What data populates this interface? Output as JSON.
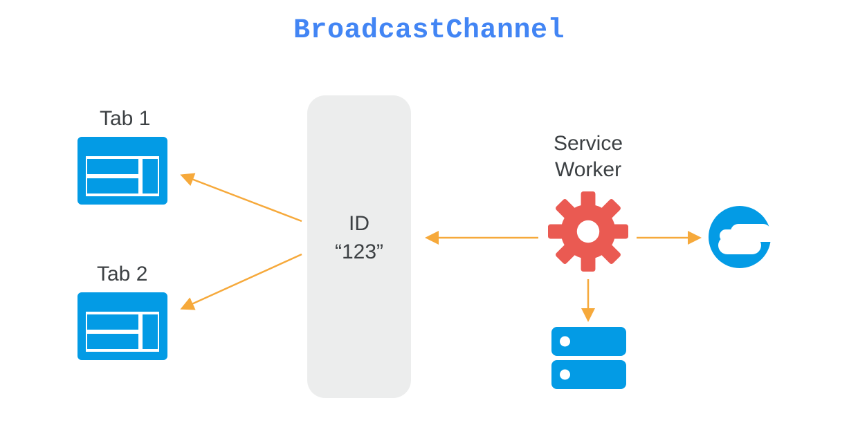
{
  "title": "BroadcastChannel",
  "colors": {
    "title": "#4285f4",
    "icon_blue": "#039be5",
    "gear": "#ea5a52",
    "arrow": "#f6a93b",
    "box_bg": "#eceded",
    "text": "#3c4043"
  },
  "channel": {
    "id_label": "ID",
    "id_value": "“123”"
  },
  "tabs": [
    {
      "label": "Tab 1"
    },
    {
      "label": "Tab 2"
    }
  ],
  "service_worker": {
    "line1": "Service",
    "line2": "Worker"
  },
  "icons": {
    "tab": "browser-window-icon",
    "gear": "gear-icon",
    "cloud": "cloud-icon",
    "server": "database-icon"
  },
  "arrows": [
    {
      "from": "channel",
      "to": "tab1"
    },
    {
      "from": "channel",
      "to": "tab2"
    },
    {
      "from": "service_worker",
      "to": "channel"
    },
    {
      "from": "service_worker",
      "to": "cloud"
    },
    {
      "from": "service_worker",
      "to": "server"
    }
  ]
}
